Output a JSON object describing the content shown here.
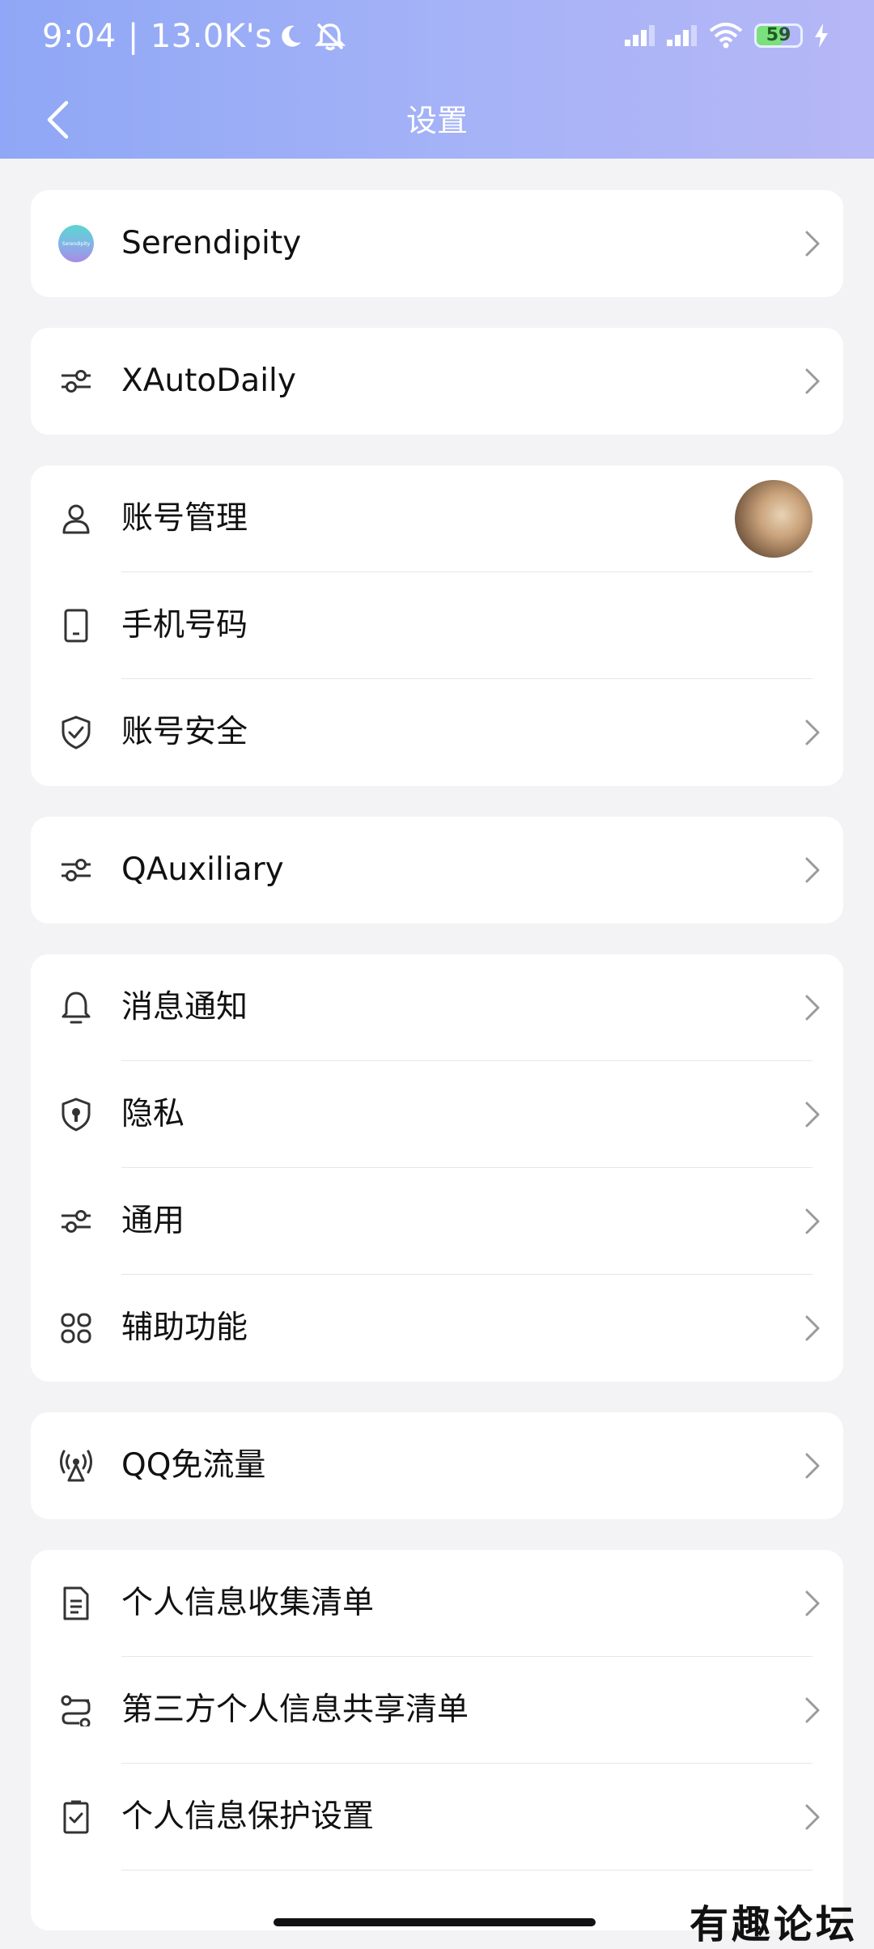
{
  "status_bar": {
    "time": "9:04",
    "separator": "|",
    "speed": "13.0K's",
    "battery_level": "59",
    "battery_fraction": 0.59
  },
  "title_bar": {
    "title": "设置"
  },
  "groups": [
    {
      "rows": [
        {
          "label": "Serendipity",
          "icon": "serendipity-avatar",
          "avatar_text": "Serendipity"
        }
      ]
    },
    {
      "rows": [
        {
          "label": "XAutoDaily",
          "icon": "sliders-icon"
        }
      ]
    },
    {
      "rows": [
        {
          "label": "账号管理",
          "icon": "user-icon"
        },
        {
          "label": "手机号码",
          "icon": "phone-icon"
        },
        {
          "label": "账号安全",
          "icon": "shield-check-icon"
        }
      ]
    },
    {
      "rows": [
        {
          "label": "QAuxiliary",
          "icon": "sliders-icon"
        }
      ]
    },
    {
      "rows": [
        {
          "label": "消息通知",
          "icon": "bell-icon"
        },
        {
          "label": "隐私",
          "icon": "shield-lock-icon"
        },
        {
          "label": "通用",
          "icon": "sliders-icon"
        },
        {
          "label": "辅助功能",
          "icon": "grid-icon"
        }
      ]
    },
    {
      "rows": [
        {
          "label": "QQ免流量",
          "icon": "signal-tower-icon"
        }
      ]
    },
    {
      "rows": [
        {
          "label": "个人信息收集清单",
          "icon": "document-icon"
        },
        {
          "label": "第三方个人信息共享清单",
          "icon": "share-list-icon"
        },
        {
          "label": "个人信息保护设置",
          "icon": "checkbox-doc-icon"
        }
      ]
    }
  ],
  "watermark": "有趣论坛",
  "colors": {
    "header_start": "#8fa7f6",
    "header_end": "#b6b7f6",
    "background": "#f3f3f5",
    "card": "#ffffff"
  }
}
